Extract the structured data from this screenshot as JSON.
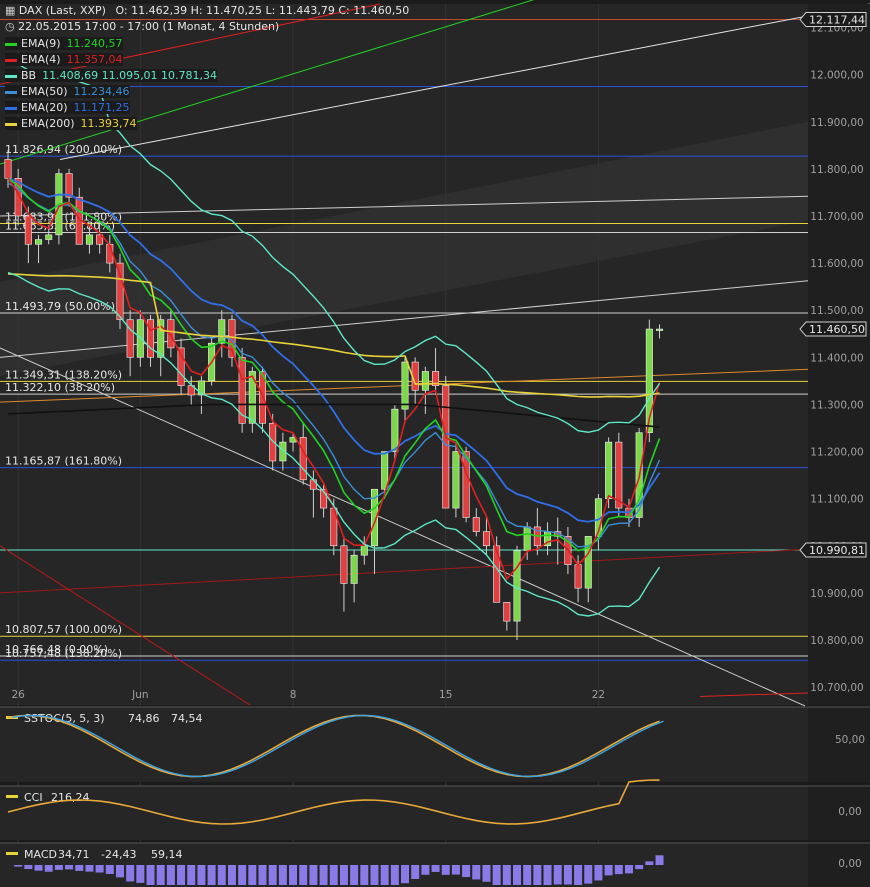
{
  "header": {
    "symbol": "DAX (Last, XXP)",
    "ohlc": "O: 11.462,39  H: 11.470,25  L: 11.443,79  C: 11.460,50",
    "period": "22.05.2015 17:00 - 17:00 (1 Monat, 4 Stunden)",
    "legend": [
      {
        "label": "EMA(9)",
        "value": "11.240,57",
        "color": "#22d422"
      },
      {
        "label": "EMA(4)",
        "value": "11.357,04",
        "color": "#e02020"
      },
      {
        "label": "BB",
        "value": "11.408,69  11.095,01  10.781,34",
        "color": "#5ee8c8"
      },
      {
        "label": "EMA(50)",
        "value": "11.234,46",
        "color": "#3a8fd8"
      },
      {
        "label": "EMA(20)",
        "value": "11.171,25",
        "color": "#2f6fe8"
      },
      {
        "label": "EMA(200)",
        "value": "11.393,74",
        "color": "#e8d23a"
      }
    ]
  },
  "level_labels": [
    {
      "text": "11.826,94 (200.00%)",
      "value": 11827
    },
    {
      "text": "11.683,93 (161.80%)",
      "value": 11684
    },
    {
      "text": "11.665,33 (61.80%)",
      "value": 11665
    },
    {
      "text": "11.493,79 (50.00%)",
      "value": 11494
    },
    {
      "text": "11.349,31 (138.20%)",
      "value": 11349
    },
    {
      "text": "11.322,10 (38.20%)",
      "value": 11322
    },
    {
      "text": "11.165,87 (161.80%)",
      "value": 11166
    },
    {
      "text": "10.807,57 (100.00%)",
      "value": 10808
    },
    {
      "text": "10.766,48 (0.00%)",
      "value": 10766
    },
    {
      "text": "10.757,48 (138.20%)",
      "value": 10757
    }
  ],
  "price_tags": [
    {
      "text": "12.117,44",
      "value": 12117
    },
    {
      "text": "11.460,50",
      "value": 11460
    },
    {
      "text": "10.990,81",
      "value": 10991
    }
  ],
  "chart_data": {
    "type": "candlestick",
    "y_ticks": [
      "12.100,00",
      "12.000,00",
      "11.900,00",
      "11.800,00",
      "11.700,00",
      "11.600,00",
      "11.500,00",
      "11.400,00",
      "11.300,00",
      "11.200,00",
      "11.100,00",
      "11.000,00",
      "10.900,00",
      "10.800,00",
      "10.700,00"
    ],
    "y_tick_values": [
      12100,
      12000,
      11900,
      11800,
      11700,
      11600,
      11500,
      11400,
      11300,
      11200,
      11100,
      11000,
      10900,
      10800,
      10700
    ],
    "x_ticks": [
      {
        "label": "26",
        "i": 1
      },
      {
        "label": "Jun",
        "i": 13
      },
      {
        "label": "8",
        "i": 28
      },
      {
        "label": "15",
        "i": 43
      },
      {
        "label": "22",
        "i": 58
      }
    ],
    "ylim": [
      10662,
      12150
    ],
    "candles": [
      [
        11820,
        11840,
        11760,
        11780
      ],
      [
        11780,
        11800,
        11680,
        11700
      ],
      [
        11700,
        11720,
        11600,
        11640
      ],
      [
        11640,
        11660,
        11600,
        11650
      ],
      [
        11650,
        11680,
        11640,
        11660
      ],
      [
        11660,
        11800,
        11640,
        11790
      ],
      [
        11790,
        11800,
        11720,
        11740
      ],
      [
        11740,
        11760,
        11640,
        11640
      ],
      [
        11640,
        11680,
        11620,
        11660
      ],
      [
        11660,
        11690,
        11620,
        11640
      ],
      [
        11640,
        11660,
        11580,
        11600
      ],
      [
        11600,
        11620,
        11460,
        11480
      ],
      [
        11480,
        11500,
        11360,
        11400
      ],
      [
        11400,
        11500,
        11380,
        11480
      ],
      [
        11480,
        11490,
        11380,
        11400
      ],
      [
        11400,
        11490,
        11360,
        11480
      ],
      [
        11480,
        11500,
        11400,
        11420
      ],
      [
        11420,
        11440,
        11320,
        11340
      ],
      [
        11340,
        11360,
        11300,
        11320
      ],
      [
        11320,
        11360,
        11280,
        11350
      ],
      [
        11350,
        11440,
        11340,
        11430
      ],
      [
        11430,
        11500,
        11400,
        11480
      ],
      [
        11480,
        11490,
        11380,
        11400
      ],
      [
        11400,
        11420,
        11240,
        11260
      ],
      [
        11260,
        11380,
        11240,
        11370
      ],
      [
        11370,
        11380,
        11240,
        11260
      ],
      [
        11260,
        11280,
        11160,
        11180
      ],
      [
        11180,
        11240,
        11160,
        11220
      ],
      [
        11220,
        11240,
        11200,
        11230
      ],
      [
        11230,
        11260,
        11130,
        11140
      ],
      [
        11140,
        11160,
        11060,
        11120
      ],
      [
        11120,
        11130,
        11060,
        11080
      ],
      [
        11080,
        11100,
        10980,
        11000
      ],
      [
        11000,
        11020,
        10860,
        10920
      ],
      [
        10920,
        10990,
        10880,
        10980
      ],
      [
        10980,
        11020,
        10960,
        11000
      ],
      [
        11000,
        11120,
        10940,
        11120
      ],
      [
        11120,
        11200,
        11100,
        11200
      ],
      [
        11200,
        11300,
        11180,
        11290
      ],
      [
        11290,
        11400,
        11260,
        11390
      ],
      [
        11390,
        11400,
        11300,
        11330
      ],
      [
        11330,
        11380,
        11280,
        11370
      ],
      [
        11370,
        11420,
        11320,
        11340
      ],
      [
        11340,
        11360,
        11080,
        11080
      ],
      [
        11080,
        11220,
        11060,
        11200
      ],
      [
        11200,
        11210,
        11050,
        11060
      ],
      [
        11060,
        11080,
        11020,
        11030
      ],
      [
        11030,
        11060,
        10980,
        11000
      ],
      [
        11000,
        11020,
        10900,
        10880
      ],
      [
        10880,
        10860,
        10820,
        10840
      ],
      [
        10840,
        11000,
        10800,
        10990
      ],
      [
        10990,
        11050,
        10970,
        11040
      ],
      [
        11040,
        11080,
        10980,
        11000
      ],
      [
        11000,
        11050,
        10980,
        11030
      ],
      [
        11030,
        11060,
        10960,
        11020
      ],
      [
        11020,
        11040,
        10940,
        10960
      ],
      [
        10960,
        10980,
        10880,
        10910
      ],
      [
        10910,
        11020,
        10880,
        11020
      ],
      [
        11020,
        11110,
        10990,
        11100
      ],
      [
        11100,
        11230,
        11080,
        11220
      ],
      [
        11220,
        11240,
        11060,
        11080
      ],
      [
        11080,
        11100,
        11040,
        11060
      ],
      [
        11060,
        11250,
        11040,
        11240
      ],
      [
        11240,
        11480,
        11220,
        11460
      ],
      [
        11460,
        11470,
        11440,
        11460
      ]
    ]
  },
  "panels": [
    {
      "label": "SSTOC(5, 5, 3)",
      "values": [
        "74,86",
        "74,54"
      ],
      "tick": "50,00"
    },
    {
      "label": "CCI",
      "values": [
        "216,24"
      ],
      "tick": "0,00"
    },
    {
      "label": "MACD",
      "values": [
        "34,71",
        "-24,43",
        "59,14"
      ],
      "tick": "0,00"
    }
  ]
}
